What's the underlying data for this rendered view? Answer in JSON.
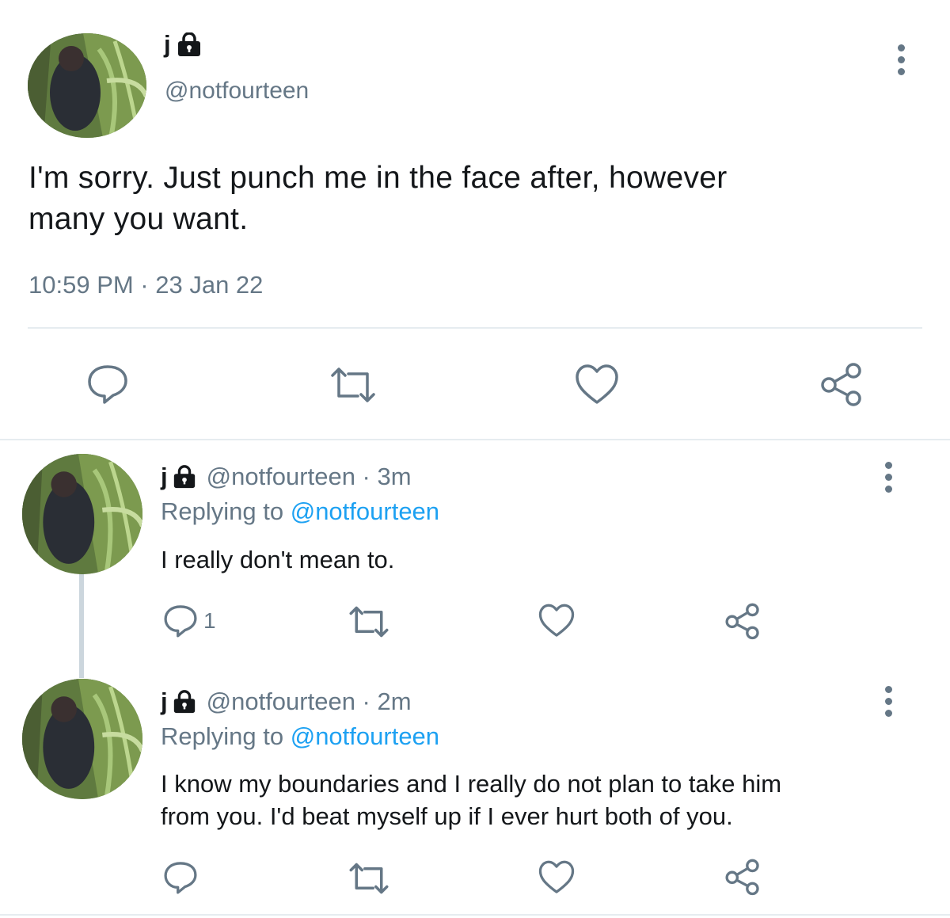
{
  "main_tweet": {
    "name": "j",
    "handle": "@notfourteen",
    "text_line1": "I'm sorry. Just punch me in the face after, however",
    "text_line2": "many you want.",
    "timestamp": "10:59 PM · 23 Jan 22"
  },
  "replies": [
    {
      "name": "j",
      "handle_time": "@notfourteen · 3m",
      "replying_prefix": "Replying to",
      "replying_to": "@notfourteen",
      "text_line1": "I really don't mean to.",
      "text_line2": "",
      "reply_count": "1"
    },
    {
      "name": "j",
      "handle_time": "@notfourteen · 2m",
      "replying_prefix": "Replying to",
      "replying_to": "@notfourteen",
      "text_line1": "I know my boundaries and I really do not plan to take him",
      "text_line2": "from you. I'd beat myself up if I ever hurt both of you.",
      "reply_count": ""
    }
  ],
  "icons": {
    "lock": "lock-icon",
    "reply": "reply-icon",
    "retweet": "retweet-icon",
    "like": "heart-icon",
    "share": "share-icon",
    "more": "more-options-icon"
  },
  "colors": {
    "text": "#14171a",
    "muted": "#657786",
    "link": "#1da1f2",
    "divider": "#e6ecf0"
  }
}
